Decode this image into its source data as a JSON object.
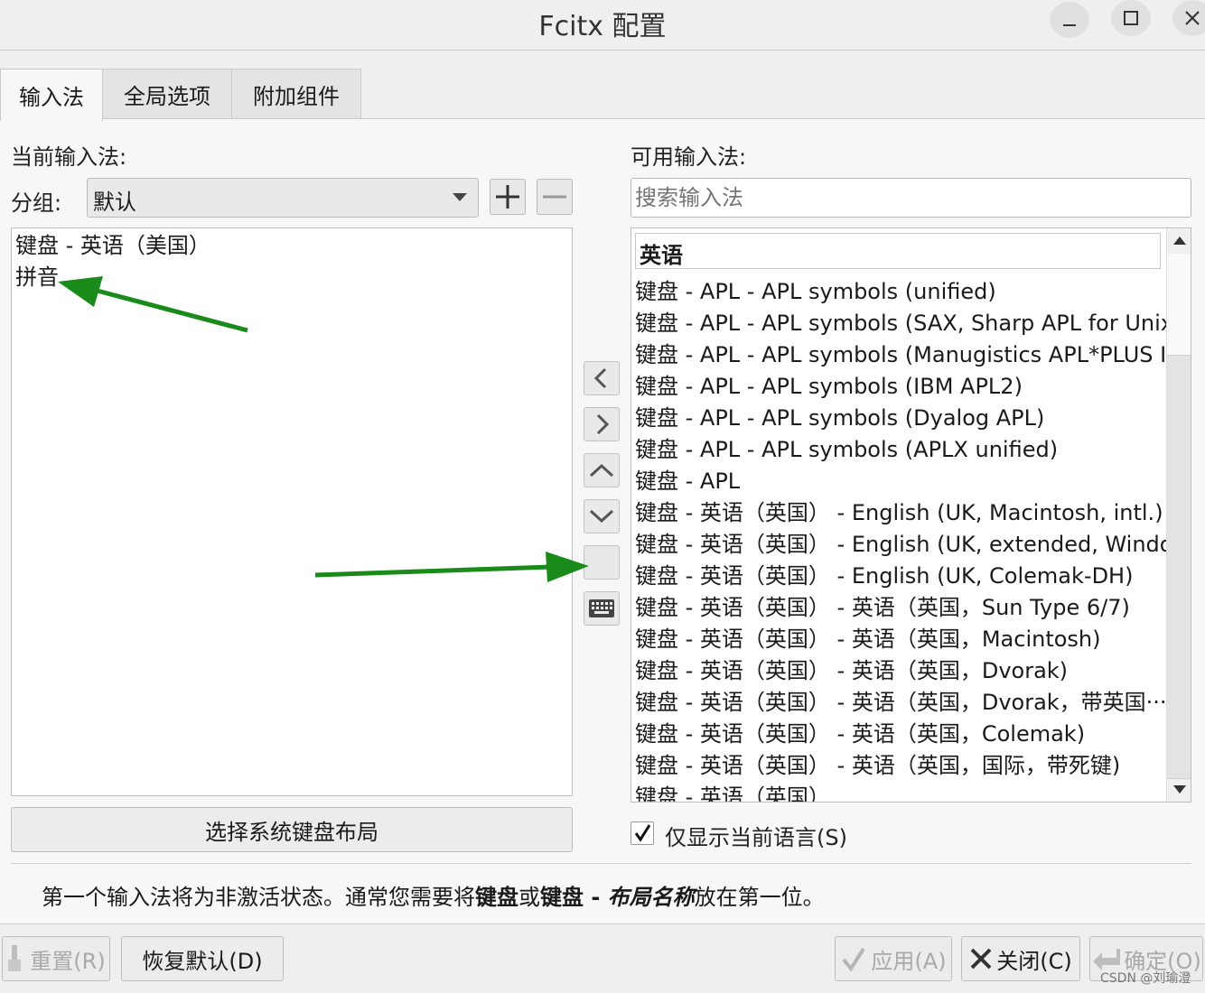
{
  "window": {
    "title": "Fcitx 配置",
    "controls": [
      "minimize-icon",
      "maximize-icon",
      "close-icon"
    ]
  },
  "tabs": [
    {
      "label": "输入法",
      "active": true
    },
    {
      "label": "全局选项",
      "active": false
    },
    {
      "label": "附加组件",
      "active": false
    }
  ],
  "left": {
    "heading": "当前输入法:",
    "group_label": "分组:",
    "group_value": "默认",
    "current_methods": [
      "键盘 - 英语（美国）",
      "拼音"
    ],
    "keyboard_layout_button": "选择系统键盘布局"
  },
  "right": {
    "heading": "可用输入法:",
    "search_placeholder": "搜索输入法",
    "section_header": "英语",
    "available_methods": [
      "键盘 - APL - APL symbols (unified)",
      "键盘 - APL - APL symbols (SAX, Sharp APL for Unix)",
      "键盘 - APL - APL symbols (Manugistics APL*PLUS II)",
      "键盘 - APL - APL symbols (IBM APL2)",
      "键盘 - APL - APL symbols (Dyalog APL)",
      "键盘 - APL - APL symbols (APLX unified)",
      "键盘 - APL",
      "键盘 - 英语（英国） - English (UK, Macintosh, intl.)",
      "键盘 - 英语（英国） - English (UK, extended, Windo···",
      "键盘 - 英语（英国） - English (UK, Colemak-DH)",
      "键盘 - 英语（英国） - 英语（英国，Sun Type 6/7)",
      "键盘 - 英语（英国） - 英语（英国，Macintosh)",
      "键盘 - 英语（英国） - 英语（英国，Dvorak)",
      "键盘 - 英语（英国） - 英语（英国，Dvorak，带英国···",
      "键盘 - 英语（英国） - 英语（英国，Colemak)",
      "键盘 - 英语（英国） - 英语（英国，国际，带死键)",
      "键盘 - 英语（英国）"
    ],
    "only_current_language_label": "仅显示当前语言(S)",
    "only_current_language_checked": true
  },
  "hint": {
    "part1": "第一个输入法将为非激活状态。通常您需要将",
    "bold1": "键盘",
    "part2": "或",
    "bold2": "键盘 - ",
    "bolditalic": "布局名称",
    "part3": "放在第一位。"
  },
  "footer": {
    "reset": "重置(R)",
    "restore_defaults": "恢复默认(D)",
    "apply": "应用(A)",
    "close": "关闭(C)",
    "ok": "确定(O)",
    "watermark": "CSDN @刘瑜澄"
  },
  "colors": {
    "annotation_arrow": "#1a8a1a",
    "window_bg": "#efefef",
    "panel_bg": "#f7f7f7"
  }
}
